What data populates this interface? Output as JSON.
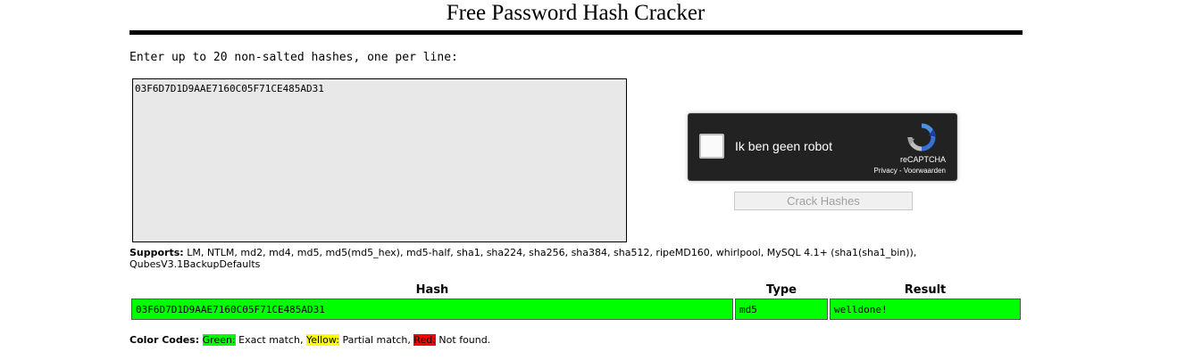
{
  "page": {
    "title": "Free Password Hash Cracker",
    "instructions": "Enter up to 20 non-salted hashes, one per line:"
  },
  "input": {
    "value": "03F6D7D1D9AAE7160C05F71CE485AD31"
  },
  "captcha": {
    "label": "Ik ben geen robot",
    "brand": "reCAPTCHA",
    "privacy": "Privacy",
    "separator": " - ",
    "terms": "Voorwaarden",
    "logo_icon": "recaptcha-icon"
  },
  "crack_button": {
    "label": "Crack Hashes"
  },
  "supports": {
    "label": "Supports:",
    "text": "LM, NTLM, md2, md4, md5, md5(md5_hex), md5-half, sha1, sha224, sha256, sha384, sha512, ripeMD160, whirlpool, MySQL 4.1+ (sha1(sha1_bin)), QubesV3.1BackupDefaults"
  },
  "results": {
    "headers": {
      "hash": "Hash",
      "type": "Type",
      "result": "Result"
    },
    "rows": [
      {
        "hash": "03F6D7D1D9AAE7160C05F71CE485AD31",
        "type": "md5",
        "result": "welldone!",
        "status_color": "#00ff00"
      }
    ]
  },
  "color_codes": {
    "label": "Color Codes:",
    "green": "Green:",
    "green_desc": " Exact match, ",
    "yellow": "Yellow:",
    "yellow_desc": " Partial match, ",
    "red": "Red:",
    "red_desc": " Not found.",
    "colors": {
      "green": "#00ff00",
      "yellow": "#ffff00",
      "red": "#ff0000"
    }
  }
}
